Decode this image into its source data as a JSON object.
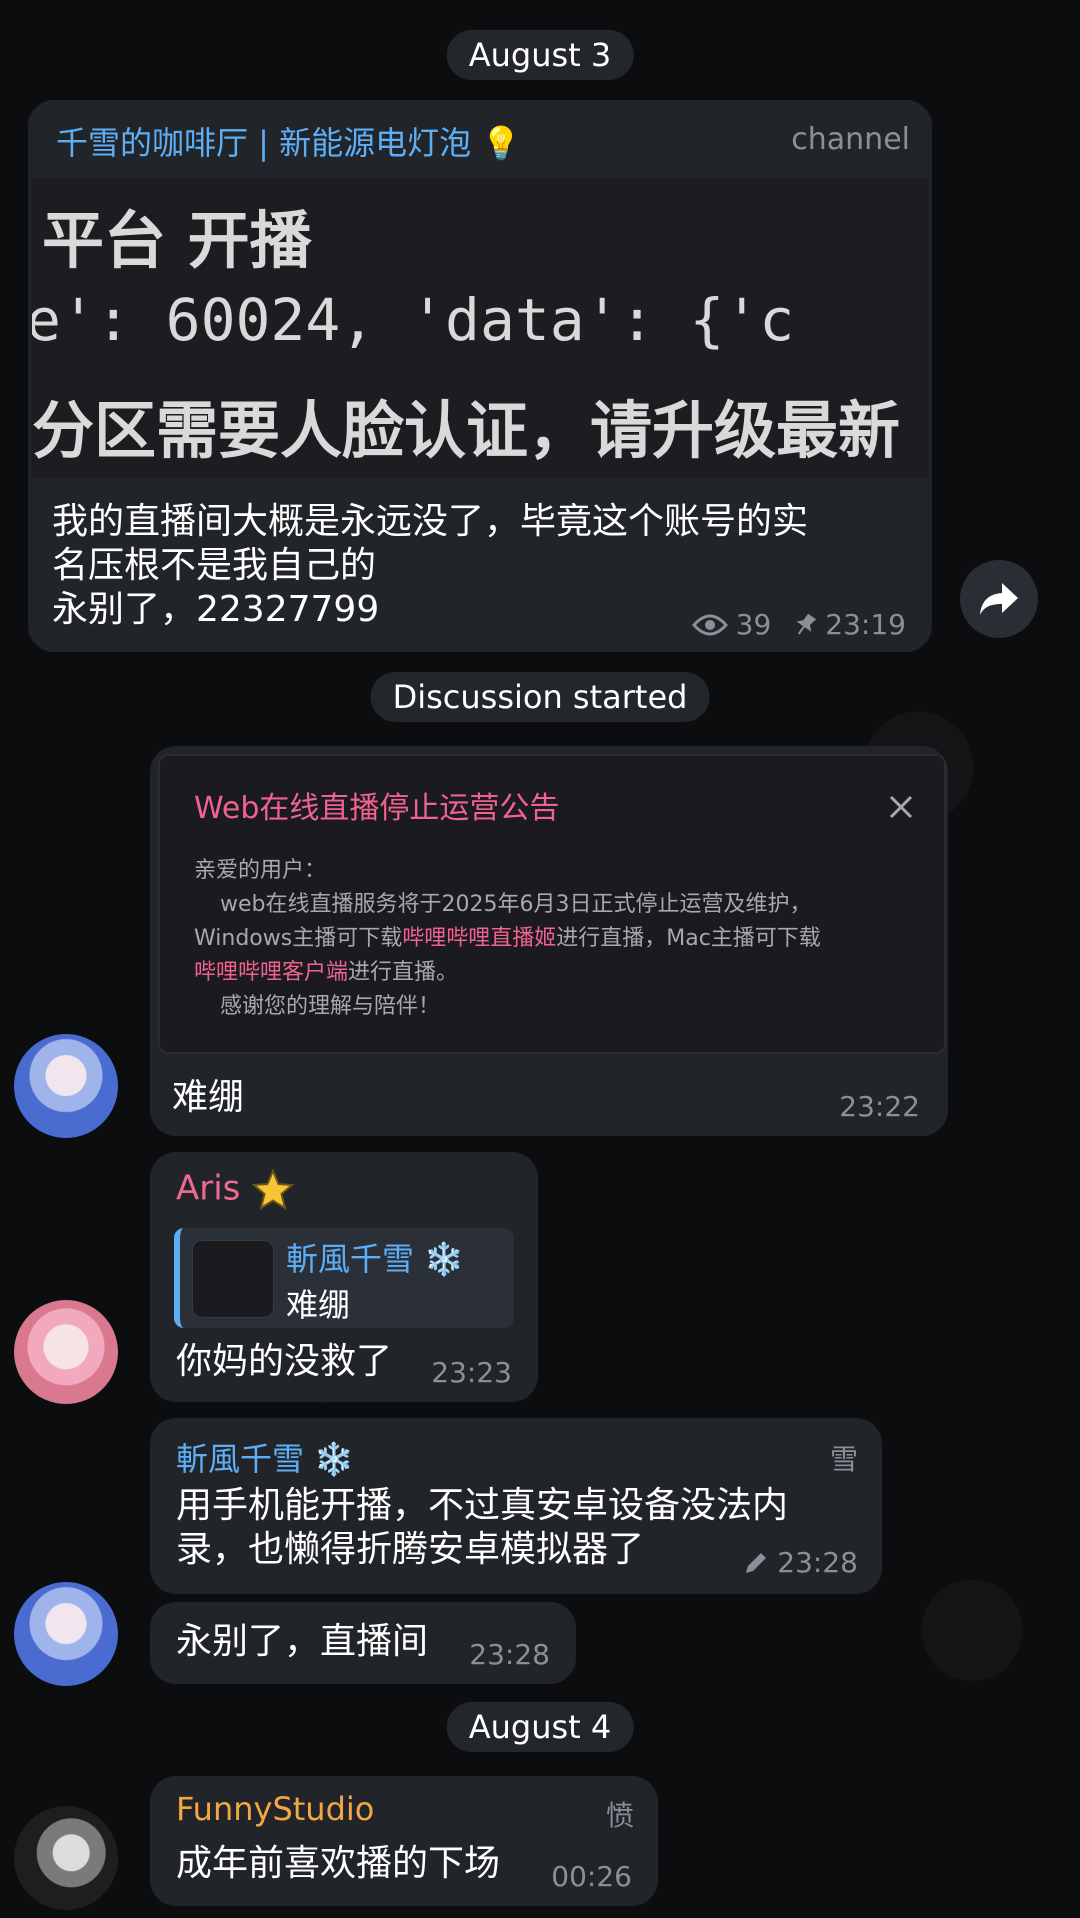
{
  "date_pills": {
    "first": "August 3",
    "discussion": "Discussion started",
    "second": "August 4"
  },
  "channel_post": {
    "channel_name": "千雪的咖啡厅 | 新能源电灯泡 💡",
    "badge": "channel",
    "image_lines": [
      "平台  开播",
      "e': 60024, 'data': {'c",
      "分区需要人脸认证，请升级最新"
    ],
    "text_lines": [
      "我的直播间大概是永远没了，毕竟这个账号的实",
      "名压根不是我自己的",
      "永别了，22327799"
    ],
    "views": "39",
    "time": "23:19"
  },
  "messages": [
    {
      "notice": {
        "title": "Web在线直播停止运营公告",
        "line1": "亲爱的用户：",
        "line2": "web在线直播服务将于2025年6月3日正式停止运营及维护，",
        "line3a": "Windows主播可下载",
        "line3b": "哔哩哔哩直播姬",
        "line3c": "进行直播，Mac主播可下载",
        "line4a": "哔哩哔哩客户端",
        "line4b": "进行直播。",
        "line5": "感谢您的理解与陪伴！"
      },
      "text": "难绷",
      "time": "23:22"
    },
    {
      "sender": "Aris",
      "sender_emoji": "⭐",
      "reply_name": "斬風千雪 ❄️",
      "reply_text": "难绷",
      "text": "你妈的没救了",
      "time": "23:23"
    },
    {
      "sender": "斬風千雪 ❄️",
      "tag": "雪",
      "text_lines": [
        "用手机能开播，不过真安卓设备没法内",
        "录，也懒得折腾安卓模拟器了"
      ],
      "time": "23:28"
    },
    {
      "text": "永别了，直播间",
      "time": "23:28"
    },
    {
      "sender": "FunnyStudio",
      "tag": "愤",
      "text": "成年前喜欢播的下场",
      "time": "00:26"
    }
  ],
  "colors": {
    "link_blue": "#5eaef5",
    "pink_name": "#ef6a8f",
    "orange_name": "#f2a745",
    "bubble": "#212429"
  },
  "icons": [
    "eye-icon",
    "pin-icon",
    "forward-icon",
    "close-icon",
    "pencil-icon",
    "snowflake-icon",
    "star-icon"
  ]
}
